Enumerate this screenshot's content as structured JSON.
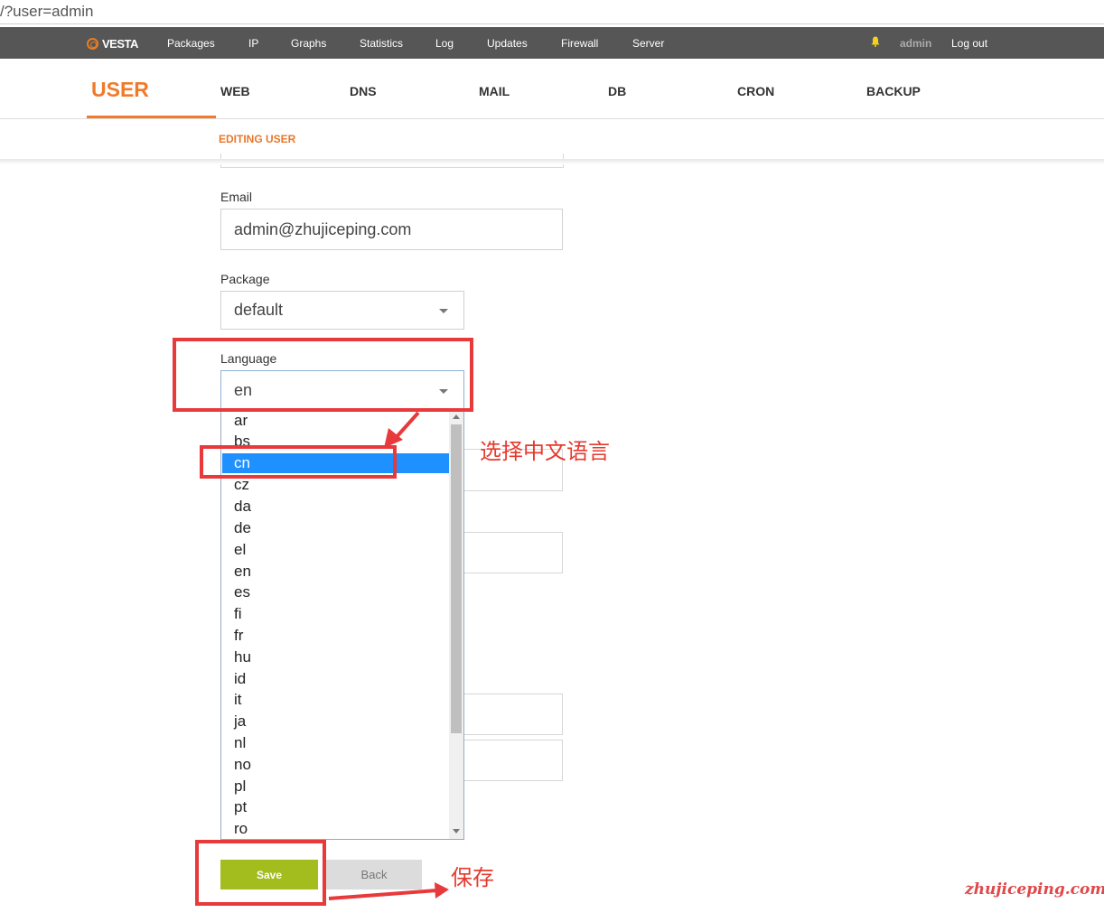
{
  "browser": {
    "url": "/?user=admin"
  },
  "topnav": {
    "logo": "VESTA",
    "items": [
      "Packages",
      "IP",
      "Graphs",
      "Statistics",
      "Log",
      "Updates",
      "Firewall",
      "Server"
    ],
    "user": "admin",
    "logout": "Log out"
  },
  "tabs": {
    "active": "USER",
    "items": [
      "WEB",
      "DNS",
      "MAIL",
      "DB",
      "CRON",
      "BACKUP"
    ]
  },
  "subtitle": "EDITING USER",
  "form": {
    "email_label": "Email",
    "email_value": "admin@zhujiceping.com",
    "package_label": "Package",
    "package_value": "default",
    "language_label": "Language",
    "language_value": "en",
    "language_options": [
      "ar",
      "bs",
      "cn",
      "cz",
      "da",
      "de",
      "el",
      "en",
      "es",
      "fi",
      "fr",
      "hu",
      "id",
      "it",
      "ja",
      "nl",
      "no",
      "pl",
      "pt",
      "ro"
    ],
    "language_highlighted": "cn"
  },
  "buttons": {
    "save": "Save",
    "back": "Back"
  },
  "annotations": {
    "select_chinese": "选择中文语言",
    "save": "保存",
    "watermark": "zhujiceping.com"
  },
  "colors": {
    "accent": "#f07a2a",
    "nav_bg": "#565656",
    "save_bg": "#a3bd1f",
    "highlight": "#1e90ff",
    "annotation_red": "#e8393b"
  }
}
